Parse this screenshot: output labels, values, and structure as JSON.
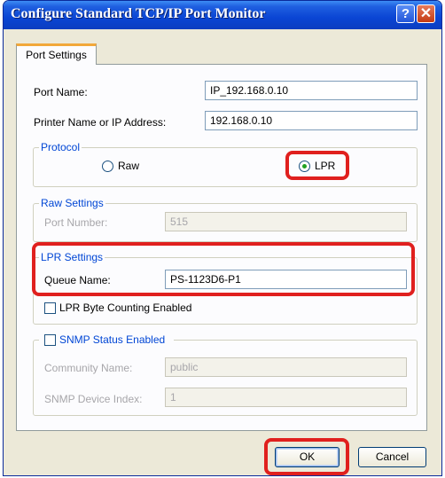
{
  "window": {
    "title": "Configure Standard TCP/IP Port Monitor",
    "help": "?",
    "close": "✕"
  },
  "tab": {
    "label": "Port Settings"
  },
  "fields": {
    "port_name": {
      "label": "Port Name:",
      "value": "IP_192.168.0.10"
    },
    "printer_name": {
      "label": "Printer Name or IP Address:",
      "value": "192.168.0.10"
    }
  },
  "protocol": {
    "legend": "Protocol",
    "raw_label": "Raw",
    "lpr_label": "LPR",
    "selected": "LPR"
  },
  "raw_settings": {
    "legend": "Raw Settings",
    "port_number_label": "Port Number:",
    "port_number_value": "515"
  },
  "lpr_settings": {
    "legend": "LPR Settings",
    "queue_name_label": "Queue Name:",
    "queue_name_value": "PS-1123D6-P1",
    "byte_counting_label": "LPR Byte Counting Enabled",
    "byte_counting_checked": false
  },
  "snmp": {
    "enabled_label": "SNMP Status Enabled",
    "enabled_checked": false,
    "community_label": "Community Name:",
    "community_value": "public",
    "device_index_label": "SNMP Device Index:",
    "device_index_value": "1"
  },
  "buttons": {
    "ok": "OK",
    "cancel": "Cancel"
  },
  "highlight_color": "#e0201e"
}
